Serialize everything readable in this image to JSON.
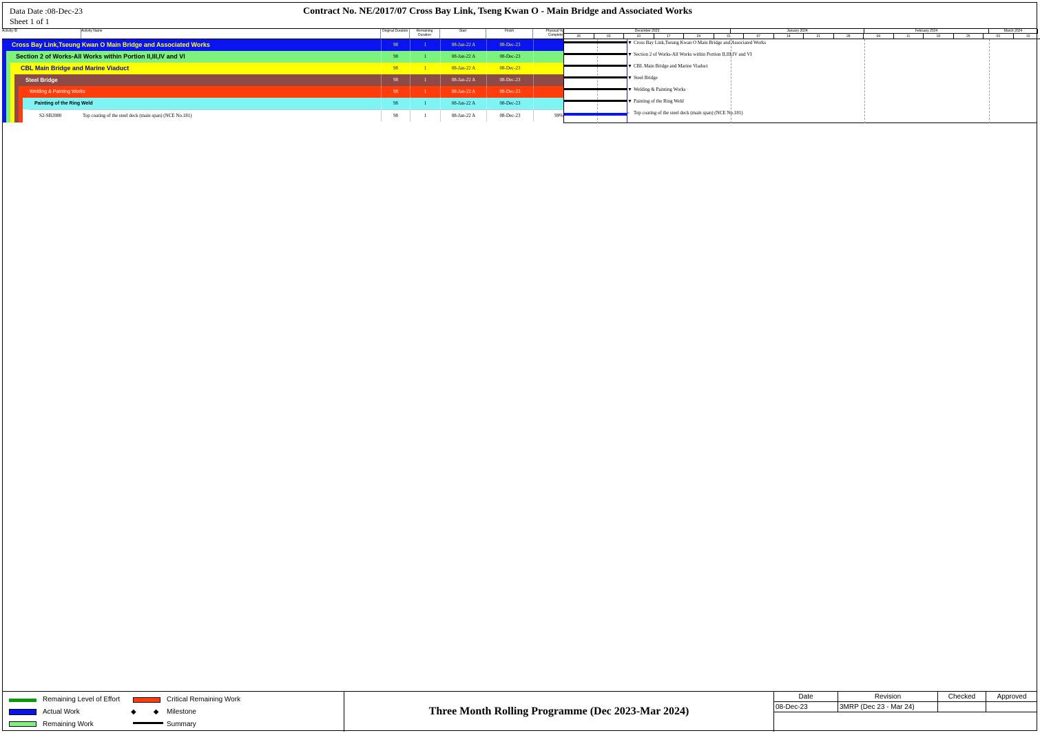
{
  "header": {
    "data_date": "Data Date :08-Dec-23",
    "sheet": "Sheet 1 of 1",
    "title": "Contract  No. NE/2017/07  Cross Bay Link, Tseng Kwan O - Main Bridge and Associated Works"
  },
  "columns": {
    "activity_id": "Activity ID",
    "activity_name": "Activity Name",
    "original_duration": "Original Duration",
    "remaining_duration": "Remaining Duration",
    "start": "Start",
    "finish": "Finish",
    "physical_complete": "Physical % Complete"
  },
  "rows": [
    {
      "id": "",
      "name": "Cross Bay Link,Tseung Kwan O Main Bridge and Associated Works",
      "orig": "98",
      "rem": "1",
      "start": "08-Jan-22 A",
      "finish": "08-Dec-23",
      "pct": "",
      "bg": "#0a14ee",
      "fg": "#ffff33",
      "gantt_label": "Cross Bay Link,Tseung Kwan O Main Bridge and Associated Works"
    },
    {
      "id": "",
      "name": "Section 2 of Works-All Works within Portion II,III,IV and VI",
      "orig": "98",
      "rem": "1",
      "start": "08-Jan-22 A",
      "finish": "08-Dec-23",
      "pct": "",
      "bg": "#7ef27e",
      "fg": "#000000",
      "gantt_label": "Section 2 of Works-All Works within Portion II,III,IV and VI"
    },
    {
      "id": "",
      "name": "CBL Main Bridge and Marine Viaduct",
      "orig": "98",
      "rem": "1",
      "start": "08-Jan-22 A",
      "finish": "08-Dec-23",
      "pct": "",
      "bg": "#ffff00",
      "fg": "#0a0aa0",
      "gantt_label": "CBL Main Bridge and Marine Viaduct"
    },
    {
      "id": "",
      "name": "Steel Bridge",
      "orig": "98",
      "rem": "1",
      "start": "08-Jan-22 A",
      "finish": "08-Dec-23",
      "pct": "",
      "bg": "#8b4a44",
      "fg": "#ffffff",
      "gantt_label": "Steel Bridge"
    },
    {
      "id": "",
      "name": "Welding & Painting Works",
      "orig": "98",
      "rem": "1",
      "start": "08-Jan-22 A",
      "finish": "08-Dec-23",
      "pct": "",
      "bg": "#ff3c0a",
      "fg": "#ffffff",
      "gantt_label": "Welding & Painting Works"
    },
    {
      "id": "",
      "name": "Painting of the Ring Weld",
      "orig": "98",
      "rem": "1",
      "start": "08-Jan-22 A",
      "finish": "08-Dec-23",
      "pct": "",
      "bg": "#7ef4f4",
      "fg": "#000000",
      "gantt_label": "Painting of the Ring Weld"
    },
    {
      "id": "S2-SB2080",
      "name": "Top coating of the steel deck (main span) (NCE No.181)",
      "orig": "98",
      "rem": "1",
      "start": "08-Jan-22 A",
      "finish": "08-Dec-23",
      "pct": "99%",
      "bg": "#ffffff",
      "fg": "#000000",
      "gantt_label": "Top coating of the steel deck (main span) (NCE No.181)"
    }
  ],
  "timeline": {
    "months": [
      "December 2023",
      "January 2024",
      "February 2024",
      "March 2024"
    ],
    "weeks": [
      "26",
      "03",
      "10",
      "17",
      "24",
      "31",
      "07",
      "14",
      "21",
      "28",
      "04",
      "11",
      "18",
      "25",
      "03",
      "10"
    ]
  },
  "legend": {
    "remaining_level_of_effort": "Remaining Level of Effort",
    "actual_work": "Actual Work",
    "remaining_work": "Remaining Work",
    "critical_remaining_work": "Critical Remaining Work",
    "milestone": "Milestone",
    "summary": "Summary"
  },
  "programme_title": "Three Month Rolling Programme (Dec 2023-Mar 2024)",
  "revision_table": {
    "headers": [
      "Date",
      "Revision",
      "Checked",
      "Approved"
    ],
    "row": [
      "08-Dec-23",
      "3MRP (Dec 23 - Mar 24)",
      "",
      ""
    ]
  },
  "colors": {
    "green": "#0a9a0a",
    "actual_blue": "#0a14ee",
    "remaining_green": "#7ef27e",
    "critical_red": "#ff3c0a"
  }
}
